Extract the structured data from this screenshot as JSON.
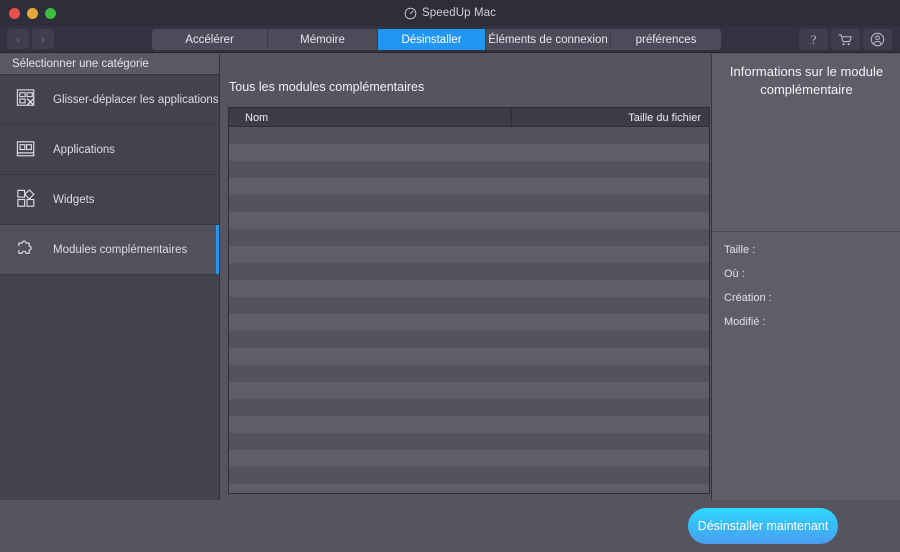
{
  "window": {
    "title": "SpeedUp Mac",
    "logo_icon": "speedometer-icon",
    "traffic_lights": [
      "close-button",
      "minimize-button",
      "maximize-button"
    ]
  },
  "toolbar": {
    "back_label": "‹",
    "forward_label": "›",
    "tabs": [
      {
        "label": "Accélérer",
        "active": false
      },
      {
        "label": "Mémoire",
        "active": false
      },
      {
        "label": "Désinstaller",
        "active": true
      },
      {
        "label": "Éléments de connexion",
        "active": false
      },
      {
        "label": "préférences",
        "active": false
      }
    ],
    "help_label": "?",
    "actions": [
      "help-button",
      "cart-button",
      "account-button"
    ]
  },
  "sidebar": {
    "header": "Sélectionner une catégorie",
    "items": [
      {
        "label": "Glisser-déplacer les applications",
        "icon": "drag-drop-apps-icon",
        "selected": false
      },
      {
        "label": "Applications",
        "icon": "applications-grid-icon",
        "selected": false
      },
      {
        "label": "Widgets",
        "icon": "widgets-icon",
        "selected": false
      },
      {
        "label": "Modules complémentaires",
        "icon": "puzzle-piece-icon",
        "selected": true
      }
    ]
  },
  "main": {
    "title": "Tous les modules complémentaires",
    "table": {
      "columns": [
        "Nom",
        "Taille du fichier"
      ],
      "rows": []
    }
  },
  "info_panel": {
    "title": "Informations sur le module complémentaire",
    "fields": [
      {
        "label": "Taille :",
        "value": ""
      },
      {
        "label": "Où :",
        "value": ""
      },
      {
        "label": "Création :",
        "value": ""
      },
      {
        "label": "Modifié :",
        "value": ""
      }
    ]
  },
  "footer": {
    "uninstall_label": "Désinstaller maintenant"
  },
  "colors": {
    "accent_blue": "#2196f3",
    "button_cyan": "#2fd9ff",
    "window_bg": "#55545f",
    "titlebar_bg": "#2e2e3a",
    "sidebar_bg": "#43434f"
  }
}
